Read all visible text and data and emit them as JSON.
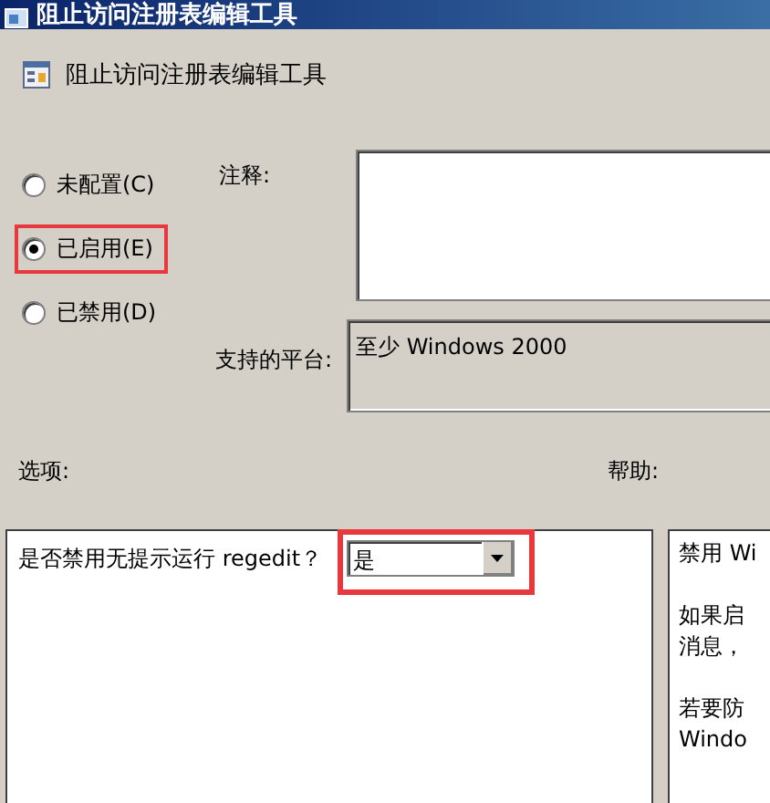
{
  "window": {
    "title": "阻止访问注册表编辑工具"
  },
  "header": {
    "title": "阻止访问注册表编辑工具"
  },
  "state_options": [
    {
      "label": "未配置(C)",
      "selected": false,
      "highlighted": false
    },
    {
      "label": "已启用(E)",
      "selected": true,
      "highlighted": true
    },
    {
      "label": "已禁用(D)",
      "selected": false,
      "highlighted": false
    }
  ],
  "comment": {
    "label": "注释:"
  },
  "platform": {
    "label": "支持的平台:",
    "value": "至少 Windows 2000"
  },
  "options": {
    "label": "选项:",
    "setting_label": "是否禁用无提示运行 regedit？",
    "dropdown": {
      "value": "是",
      "highlighted": true
    }
  },
  "help": {
    "label": "帮助:",
    "paragraphs": [
      [
        "禁用 Wi"
      ],
      [
        "如果启",
        "消息，"
      ],
      [
        "若要防",
        "Windo"
      ]
    ]
  }
}
